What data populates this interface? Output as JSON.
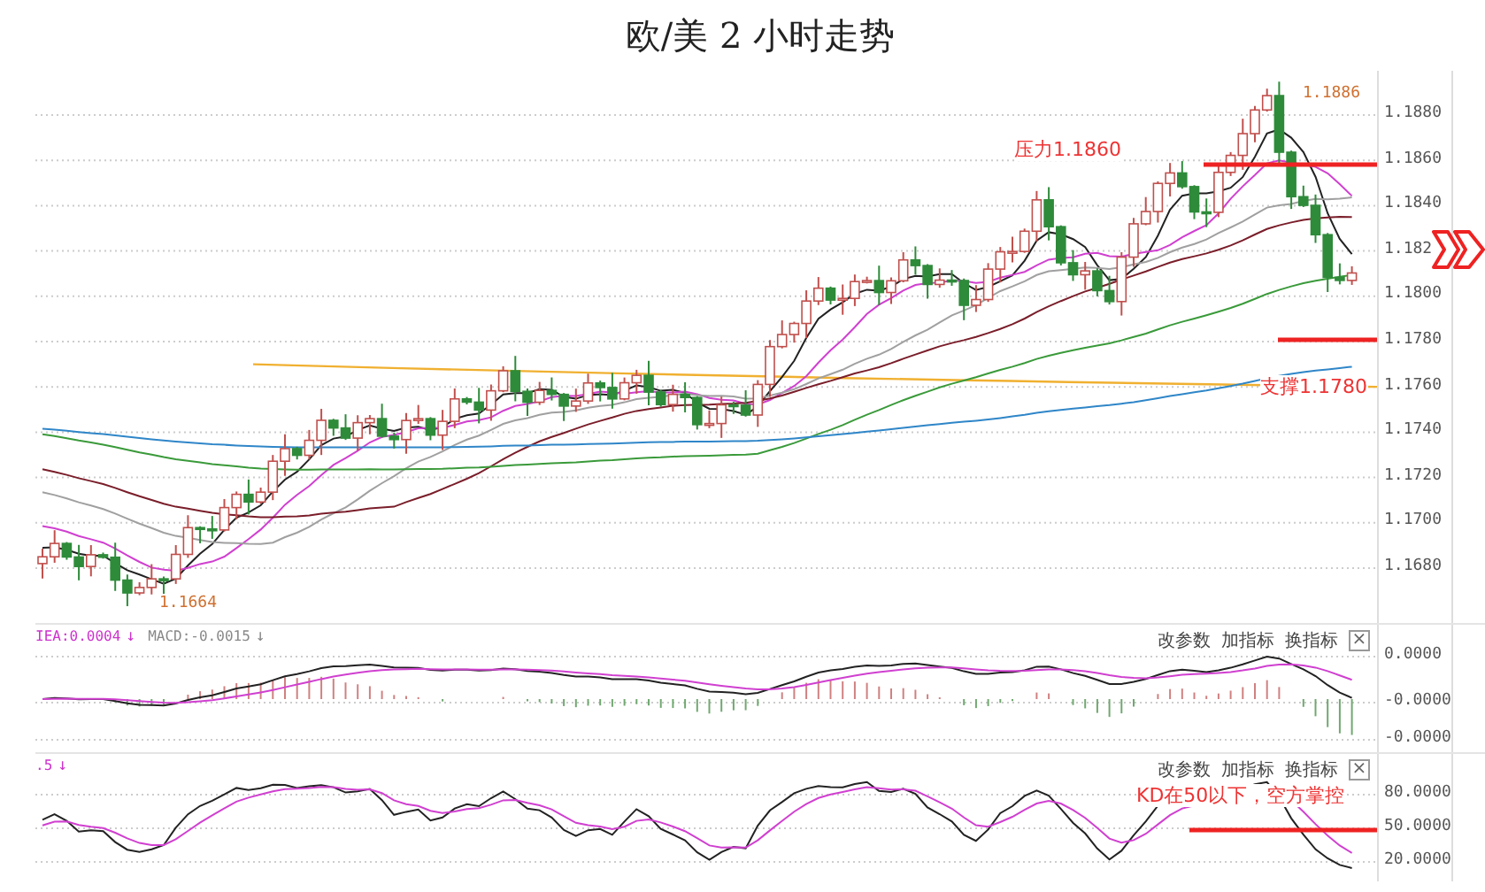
{
  "title": "欧/美 2 小时走势",
  "main_chart": {
    "y_axis_labels": [
      "1.1880",
      "1.1860",
      "1.1840",
      "1.182",
      "1.1800",
      "1.1780",
      "1.1760",
      "1.1740",
      "1.1720",
      "1.1700",
      "1.1680"
    ],
    "high_label": "1.1886",
    "low_label": "1.1664",
    "annotations": [
      {
        "kind": "resistance",
        "text": "压力1.1860"
      },
      {
        "kind": "support",
        "text": "支撑1.1780"
      }
    ]
  },
  "macd_panel": {
    "header": [
      {
        "label": "IEA:0.0004",
        "arrow": "↓",
        "color": "#cc33cc"
      },
      {
        "label": "MACD:-0.0015",
        "arrow": "↓",
        "color": "#888888"
      }
    ],
    "toolbar": [
      "改参数",
      "加指标",
      "换指标"
    ],
    "close": "×",
    "y_axis_labels": [
      "0.0000",
      "-0.0000",
      "-0.0000"
    ]
  },
  "kd_panel": {
    "header": [
      {
        "label": ".5",
        "arrow": "↓",
        "color": "#cc33cc"
      }
    ],
    "toolbar": [
      "改参数",
      "加指标",
      "换指标"
    ],
    "close": "×",
    "y_axis_labels": [
      "80.0000",
      "50.0000",
      "20.0000"
    ],
    "annotation": {
      "kind": "threshold",
      "text": "KD在50以下，空方掌控"
    }
  }
}
